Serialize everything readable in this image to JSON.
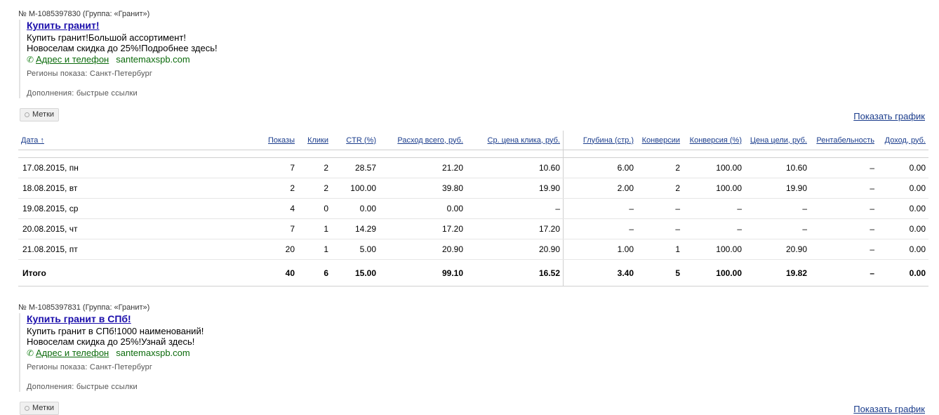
{
  "ads": [
    {
      "id_text": "№ M-1085397830",
      "group_text": "(Группа: «Гранит»)",
      "title": "Купить гранит!",
      "text_line1": "Купить гранит!Большой ассортимент!",
      "text_line2": "Новоселам скидка до 25%!Подробнее здесь!",
      "address_link": "Адрес и телефон",
      "domain": "santemaxspb.com",
      "regions": "Регионы показа: Санкт-Петербург",
      "extras": "Дополнения: быстрые ссылки",
      "tags_label": "Метки",
      "show_chart": "Показать график"
    },
    {
      "id_text": "№ M-1085397831",
      "group_text": "(Группа: «Гранит»)",
      "title": "Купить гранит в СПб!",
      "text_line1": "Купить гранит в СПб!1000 наименований!",
      "text_line2": "Новоселам скидка до 25%!Узнай здесь!",
      "address_link": "Адрес и телефон",
      "domain": "santemaxspb.com",
      "regions": "Регионы показа: Санкт-Петербург",
      "extras": "Дополнения: быстрые ссылки",
      "tags_label": "Метки",
      "show_chart": "Показать график"
    }
  ],
  "icons": {
    "phone": "phone-icon",
    "tag": "tag-icon"
  },
  "table": {
    "headers": [
      "Дата ↑",
      "Показы",
      "Клики",
      "CTR (%)",
      "Расход всего, руб.",
      "Ср. цена клика, руб.",
      "Глубина (стр.)",
      "Конверсии",
      "Конверсия (%)",
      "Цена цели, руб.",
      "Рентабельность",
      "Доход, руб."
    ],
    "rows": [
      [
        "17.08.2015, пн",
        "7",
        "2",
        "28.57",
        "21.20",
        "10.60",
        "6.00",
        "2",
        "100.00",
        "10.60",
        "–",
        "0.00"
      ],
      [
        "18.08.2015, вт",
        "2",
        "2",
        "100.00",
        "39.80",
        "19.90",
        "2.00",
        "2",
        "100.00",
        "19.90",
        "–",
        "0.00"
      ],
      [
        "19.08.2015, ср",
        "4",
        "0",
        "0.00",
        "0.00",
        "–",
        "–",
        "–",
        "–",
        "–",
        "–",
        "0.00"
      ],
      [
        "20.08.2015, чт",
        "7",
        "1",
        "14.29",
        "17.20",
        "17.20",
        "–",
        "–",
        "–",
        "–",
        "–",
        "0.00"
      ],
      [
        "21.08.2015, пт",
        "20",
        "1",
        "5.00",
        "20.90",
        "20.90",
        "1.00",
        "1",
        "100.00",
        "20.90",
        "–",
        "0.00"
      ]
    ],
    "total": [
      "Итого",
      "40",
      "6",
      "15.00",
      "99.10",
      "16.52",
      "3.40",
      "5",
      "100.00",
      "19.82",
      "–",
      "0.00"
    ]
  },
  "colors": {
    "link": "#1a0dab",
    "header_link": "#1a3c8c",
    "green": "#0c6b0c"
  }
}
